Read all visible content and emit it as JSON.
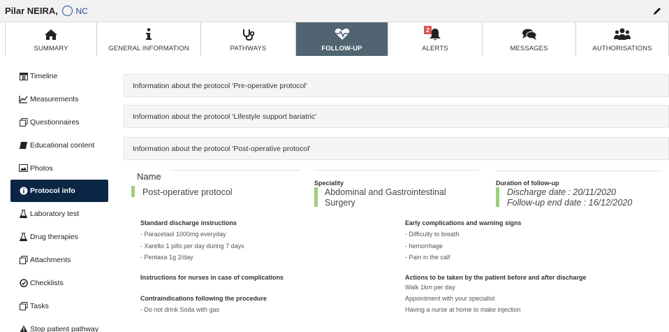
{
  "patient": {
    "name": "Pilar NEIRA,",
    "extra": "NC"
  },
  "tabs": [
    {
      "label": "SUMMARY",
      "icon": "home-icon",
      "active": false
    },
    {
      "label": "GENERAL INFORMATION",
      "icon": "info-icon",
      "active": false
    },
    {
      "label": "PATHWAYS",
      "icon": "stethoscope-icon",
      "active": false
    },
    {
      "label": "FOLLOW-UP",
      "icon": "heartbeat-icon",
      "active": true
    },
    {
      "label": "ALERTS",
      "icon": "bell-icon",
      "badge": "2",
      "active": false
    },
    {
      "label": "MESSAGES",
      "icon": "comments-icon",
      "active": false
    },
    {
      "label": "AUTHORISATIONS",
      "icon": "users-icon",
      "active": false
    }
  ],
  "sidebar": [
    {
      "label": "Timeline",
      "icon": "calendar-icon",
      "active": false
    },
    {
      "label": "Measurements",
      "icon": "line-chart-icon",
      "active": false
    },
    {
      "label": "Questionnaires",
      "icon": "copy-icon",
      "active": false
    },
    {
      "label": "Educational content",
      "icon": "book-icon",
      "active": false
    },
    {
      "label": "Photos",
      "icon": "image-icon",
      "active": false
    },
    {
      "label": "Protocol info",
      "icon": "info-circle-icon",
      "active": true
    },
    {
      "label": "Laboratory test",
      "icon": "flask-icon",
      "active": false
    },
    {
      "label": "Drug therapies",
      "icon": "flask-icon",
      "active": false
    },
    {
      "label": "Attachments",
      "icon": "copy-icon",
      "active": false
    },
    {
      "label": "Checklists",
      "icon": "check-circle-icon",
      "active": false
    },
    {
      "label": "Tasks",
      "icon": "copy-icon",
      "active": false
    },
    {
      "label": "Stop patient pathway",
      "icon": "warning-icon",
      "active": false
    }
  ],
  "protocols": [
    "Information about the protocol 'Pre-operative protocol'",
    "Information about the protocol 'Lifestyle support bariatric'",
    "Information about the protocol 'Post-operative protocol'"
  ],
  "details": {
    "name_label": "Name",
    "name_value": "Post-operative protocol",
    "speciality_label": "Speciality",
    "speciality_line1": "Abdominal and Gastrointestinal",
    "speciality_line2": "Surgery",
    "duration_label": "Duration of follow-up",
    "discharge_date": "Discharge date : 20/11/2020",
    "followup_end": "Follow-up end date : 16/12/2020"
  },
  "sections": {
    "discharge_title": "Standard discharge instructions",
    "discharge_lines": [
      "- Paracetaol 1000mg everyday",
      "- Xarelto 1 pills per day during 7 days",
      "- Pentasa 1g 2/day"
    ],
    "nurses_title": "Instructions for nurses in case of complications",
    "contra_title": "Contraindications following the procedure",
    "contra_lines": [
      "- Do not drink Soda with gas"
    ],
    "early_title": "Early complications and warning signs",
    "early_lines": [
      "- Difficulty to breath",
      "- hemorrhage",
      "- Pain in the calf"
    ],
    "actions_title": "Actions to be taken by the patient before and after discharge",
    "actions_lines": [
      "Walk 1km per day",
      "Appointment with your specialist",
      "Having a nurse at home to make injection"
    ]
  },
  "colors": {
    "active_tab": "#506471",
    "active_sidebar": "#0b2544",
    "accent_bar": "#9ccf7e",
    "badge": "#d9534f",
    "gender": "#1f4e8c"
  }
}
